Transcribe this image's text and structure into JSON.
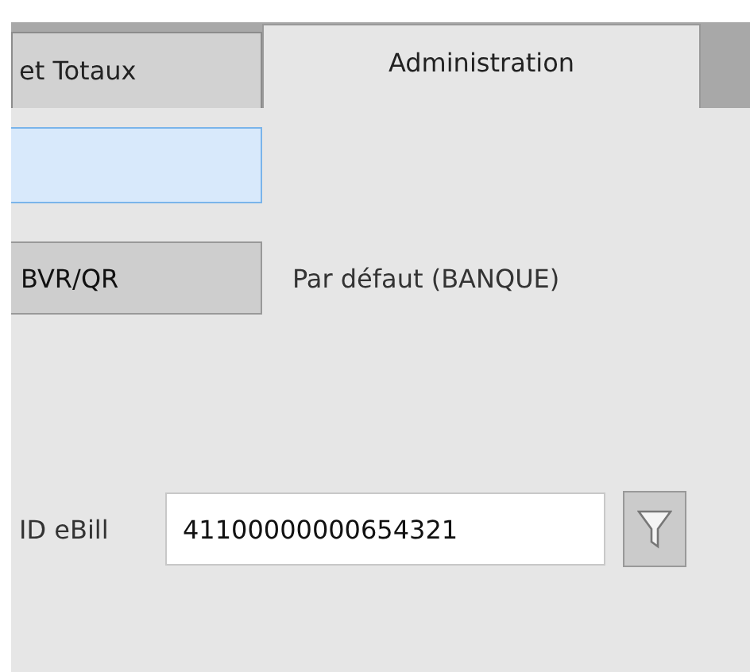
{
  "tabs": [
    {
      "label": "et Totaux",
      "selected": false
    },
    {
      "label": "Administration",
      "selected": true
    }
  ],
  "focused_field": {
    "focused": true
  },
  "slip_button": {
    "label": "BVR/QR"
  },
  "slip_default": "Par défaut (BANQUE)",
  "ebill": {
    "label": "ID eBill",
    "value": "41100000000654321"
  }
}
